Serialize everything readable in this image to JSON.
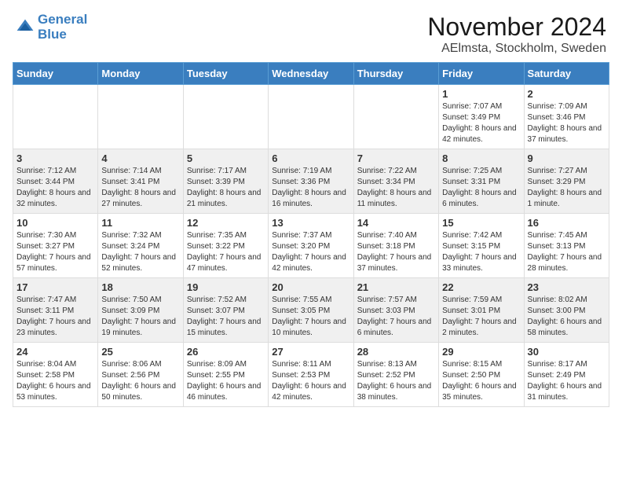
{
  "header": {
    "logo_line1": "General",
    "logo_line2": "Blue",
    "month": "November 2024",
    "location": "AElmsta, Stockholm, Sweden"
  },
  "weekdays": [
    "Sunday",
    "Monday",
    "Tuesday",
    "Wednesday",
    "Thursday",
    "Friday",
    "Saturday"
  ],
  "weeks": [
    [
      {
        "day": "",
        "info": ""
      },
      {
        "day": "",
        "info": ""
      },
      {
        "day": "",
        "info": ""
      },
      {
        "day": "",
        "info": ""
      },
      {
        "day": "",
        "info": ""
      },
      {
        "day": "1",
        "info": "Sunrise: 7:07 AM\nSunset: 3:49 PM\nDaylight: 8 hours and 42 minutes."
      },
      {
        "day": "2",
        "info": "Sunrise: 7:09 AM\nSunset: 3:46 PM\nDaylight: 8 hours and 37 minutes."
      }
    ],
    [
      {
        "day": "3",
        "info": "Sunrise: 7:12 AM\nSunset: 3:44 PM\nDaylight: 8 hours and 32 minutes."
      },
      {
        "day": "4",
        "info": "Sunrise: 7:14 AM\nSunset: 3:41 PM\nDaylight: 8 hours and 27 minutes."
      },
      {
        "day": "5",
        "info": "Sunrise: 7:17 AM\nSunset: 3:39 PM\nDaylight: 8 hours and 21 minutes."
      },
      {
        "day": "6",
        "info": "Sunrise: 7:19 AM\nSunset: 3:36 PM\nDaylight: 8 hours and 16 minutes."
      },
      {
        "day": "7",
        "info": "Sunrise: 7:22 AM\nSunset: 3:34 PM\nDaylight: 8 hours and 11 minutes."
      },
      {
        "day": "8",
        "info": "Sunrise: 7:25 AM\nSunset: 3:31 PM\nDaylight: 8 hours and 6 minutes."
      },
      {
        "day": "9",
        "info": "Sunrise: 7:27 AM\nSunset: 3:29 PM\nDaylight: 8 hours and 1 minute."
      }
    ],
    [
      {
        "day": "10",
        "info": "Sunrise: 7:30 AM\nSunset: 3:27 PM\nDaylight: 7 hours and 57 minutes."
      },
      {
        "day": "11",
        "info": "Sunrise: 7:32 AM\nSunset: 3:24 PM\nDaylight: 7 hours and 52 minutes."
      },
      {
        "day": "12",
        "info": "Sunrise: 7:35 AM\nSunset: 3:22 PM\nDaylight: 7 hours and 47 minutes."
      },
      {
        "day": "13",
        "info": "Sunrise: 7:37 AM\nSunset: 3:20 PM\nDaylight: 7 hours and 42 minutes."
      },
      {
        "day": "14",
        "info": "Sunrise: 7:40 AM\nSunset: 3:18 PM\nDaylight: 7 hours and 37 minutes."
      },
      {
        "day": "15",
        "info": "Sunrise: 7:42 AM\nSunset: 3:15 PM\nDaylight: 7 hours and 33 minutes."
      },
      {
        "day": "16",
        "info": "Sunrise: 7:45 AM\nSunset: 3:13 PM\nDaylight: 7 hours and 28 minutes."
      }
    ],
    [
      {
        "day": "17",
        "info": "Sunrise: 7:47 AM\nSunset: 3:11 PM\nDaylight: 7 hours and 23 minutes."
      },
      {
        "day": "18",
        "info": "Sunrise: 7:50 AM\nSunset: 3:09 PM\nDaylight: 7 hours and 19 minutes."
      },
      {
        "day": "19",
        "info": "Sunrise: 7:52 AM\nSunset: 3:07 PM\nDaylight: 7 hours and 15 minutes."
      },
      {
        "day": "20",
        "info": "Sunrise: 7:55 AM\nSunset: 3:05 PM\nDaylight: 7 hours and 10 minutes."
      },
      {
        "day": "21",
        "info": "Sunrise: 7:57 AM\nSunset: 3:03 PM\nDaylight: 7 hours and 6 minutes."
      },
      {
        "day": "22",
        "info": "Sunrise: 7:59 AM\nSunset: 3:01 PM\nDaylight: 7 hours and 2 minutes."
      },
      {
        "day": "23",
        "info": "Sunrise: 8:02 AM\nSunset: 3:00 PM\nDaylight: 6 hours and 58 minutes."
      }
    ],
    [
      {
        "day": "24",
        "info": "Sunrise: 8:04 AM\nSunset: 2:58 PM\nDaylight: 6 hours and 53 minutes."
      },
      {
        "day": "25",
        "info": "Sunrise: 8:06 AM\nSunset: 2:56 PM\nDaylight: 6 hours and 50 minutes."
      },
      {
        "day": "26",
        "info": "Sunrise: 8:09 AM\nSunset: 2:55 PM\nDaylight: 6 hours and 46 minutes."
      },
      {
        "day": "27",
        "info": "Sunrise: 8:11 AM\nSunset: 2:53 PM\nDaylight: 6 hours and 42 minutes."
      },
      {
        "day": "28",
        "info": "Sunrise: 8:13 AM\nSunset: 2:52 PM\nDaylight: 6 hours and 38 minutes."
      },
      {
        "day": "29",
        "info": "Sunrise: 8:15 AM\nSunset: 2:50 PM\nDaylight: 6 hours and 35 minutes."
      },
      {
        "day": "30",
        "info": "Sunrise: 8:17 AM\nSunset: 2:49 PM\nDaylight: 6 hours and 31 minutes."
      }
    ]
  ]
}
